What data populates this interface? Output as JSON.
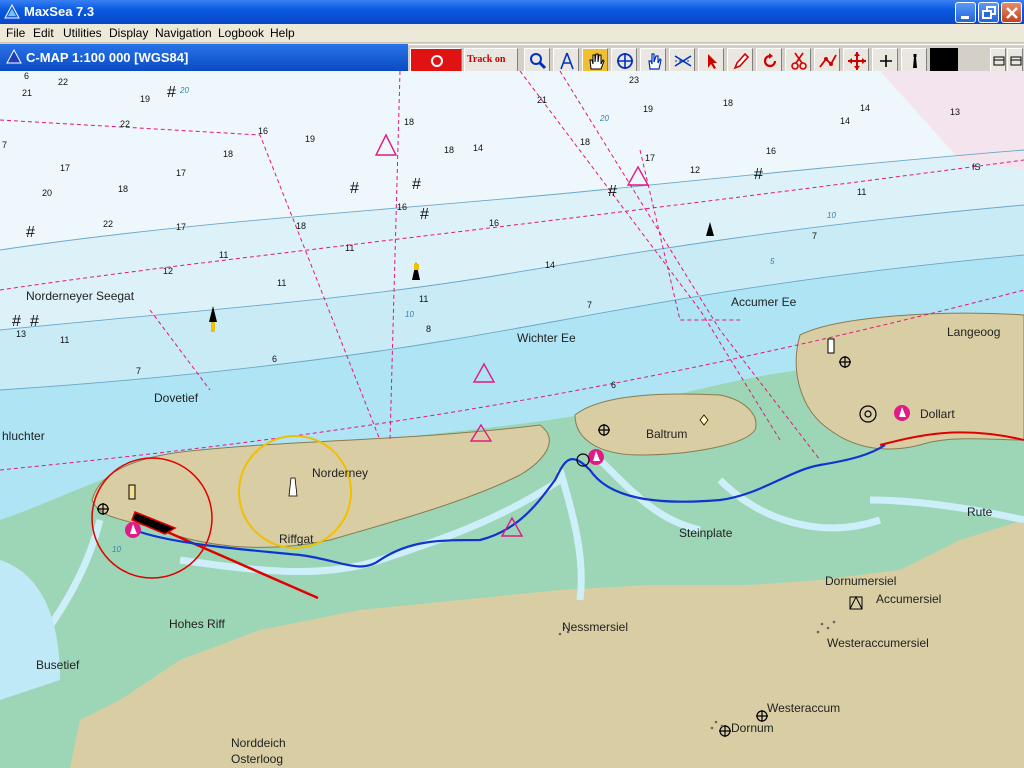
{
  "window": {
    "title": "MaxSea 7.3"
  },
  "menu": [
    "File",
    "Edit",
    "Utilities",
    "Display",
    "Navigation",
    "Logbook",
    "Help"
  ],
  "chart": {
    "title": "C-MAP  1:100 000 [WGS84]"
  },
  "toolbar": {
    "track_label": "Track on",
    "buttons": [
      "stop-icon",
      "track-on",
      "zoom-icon",
      "compass-divider-icon",
      "hand-pan-icon",
      "crosshair-icon",
      "hand-point-icon",
      "tide-arrows-icon",
      "cursor-arrow-icon",
      "pencil-icon",
      "rotate-icon",
      "scissors-icon",
      "route-icon",
      "move-icon",
      "plus-icon",
      "lighthouse-icon"
    ]
  },
  "places": [
    "Norderneyer Seegat",
    "Dovetief",
    "hluchter",
    "Norderney",
    "Riffgat",
    "Hohes Riff",
    "Busetief",
    "Norddeich",
    "Osterloog",
    "Wichter Ee",
    "Baltrum",
    "Steinplate",
    "Nessmersiel",
    "Accumer Ee",
    "Langeoog",
    "Dollart",
    "Rute",
    "Dornumersiel",
    "Accumersiel",
    "Westeraccumersiel",
    "Westeraccum",
    "Dornum"
  ],
  "soundings": {
    "wk": [
      "6",
      "16",
      "18",
      "17",
      "17",
      "14",
      "12",
      "11",
      "19",
      "17",
      "12",
      "18",
      "14"
    ],
    "plain": [
      "21",
      "22",
      "19",
      "22",
      "19",
      "18",
      "18",
      "7",
      "20",
      "18",
      "22",
      "17",
      "18",
      "16",
      "11",
      "11",
      "13",
      "11",
      "7",
      "6",
      "16",
      "14",
      "11",
      "7",
      "8",
      "21",
      "23",
      "18",
      "16",
      "14",
      "13",
      "11",
      "7",
      "6",
      "fS"
    ]
  },
  "colors": {
    "land": "#d8cba4",
    "intertidal": "#9ed6b8",
    "shallow": "#aee6f4",
    "mid": "#d4f0f8",
    "deep": "#ecf6fb",
    "track": "#1034d0",
    "route": "#e4187a",
    "heading": "#e00000",
    "range": "#f0c000"
  }
}
